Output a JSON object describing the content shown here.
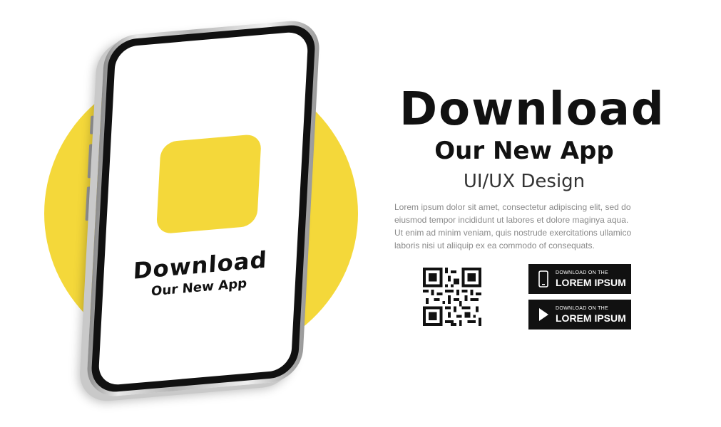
{
  "colors": {
    "accent": "#f4d83a",
    "text": "#111111",
    "muted": "#8a8a8a"
  },
  "phone": {
    "screen_title": "Download",
    "screen_subtitle": "Our New App"
  },
  "hero": {
    "headline": "Download",
    "subheadline": "Our New App",
    "tagline": "UI/UX Design",
    "body_lines": [
      "Lorem ipsum dolor sit amet, consectetur adipiscing elit, sed do",
      "eiusmod tempor incididunt ut labores et dolore maginya aqua.",
      "Ut enim ad minim veniam, quis nostrude exercitations ullamico",
      "laboris nisi ut aliiquip ex ea commodo of consequats."
    ]
  },
  "store_buttons": [
    {
      "small_label": "DOWNLOAD ON THE",
      "big_label": "LOREM IPSUM",
      "icon": "phone-icon"
    },
    {
      "small_label": "DOWNLOAD ON THE",
      "big_label": "LOREM IPSUM",
      "icon": "play-icon"
    }
  ],
  "qr": {
    "icon": "qr-code"
  }
}
